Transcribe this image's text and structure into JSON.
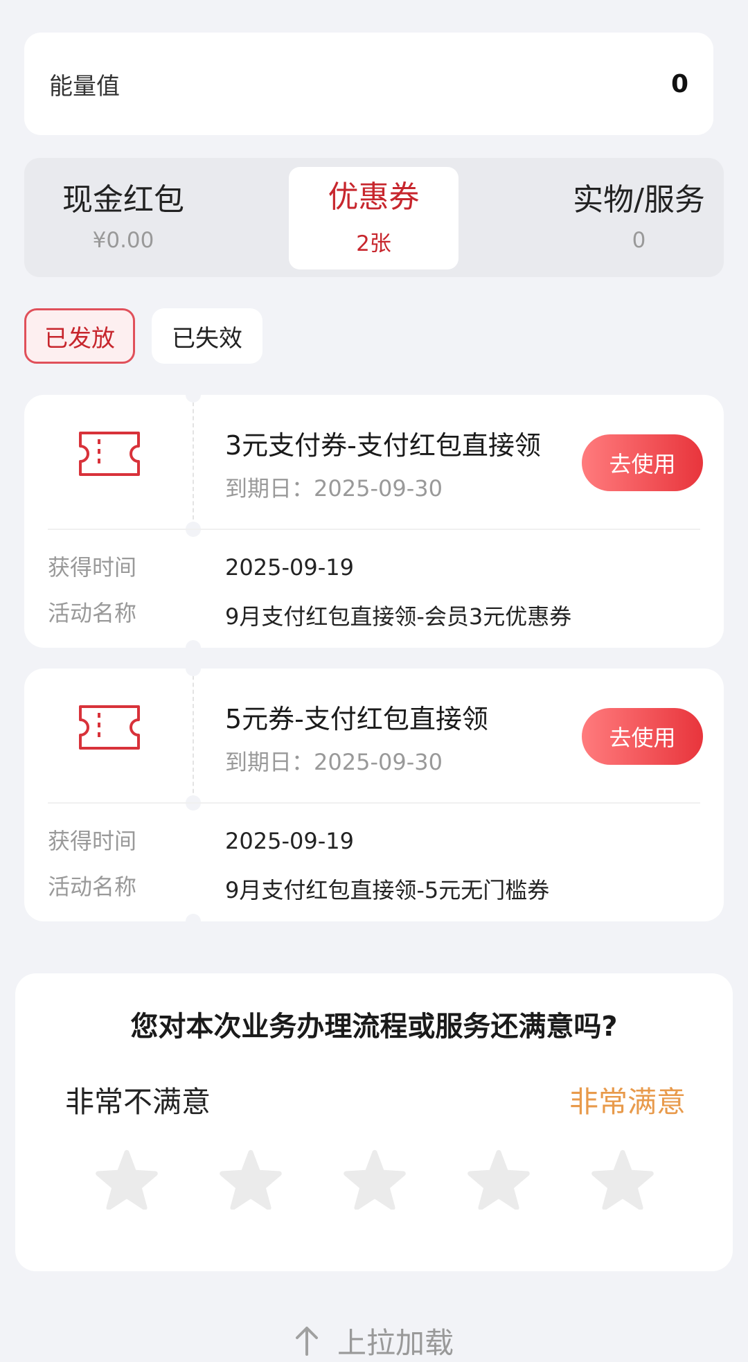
{
  "energy": {
    "label": "能量值",
    "value": "0"
  },
  "category_tabs": [
    {
      "name": "现金红包",
      "sub": "¥0.00",
      "active": false
    },
    {
      "name": "优惠券",
      "sub": "2张",
      "active": true
    },
    {
      "name": "实物/服务",
      "sub": "0",
      "active": false
    }
  ],
  "status_filters": {
    "issued": "已发放",
    "expired": "已失效"
  },
  "coupons": [
    {
      "title": "3元支付券-支付红包直接领",
      "expiry": "到期日：2025-09-30",
      "use_label": "去使用",
      "obtained_label": "获得时间",
      "obtained_value": "2025-09-19",
      "activity_label": "活动名称",
      "activity_value": "9月支付红包直接领-会员3元优惠券"
    },
    {
      "title": "5元券-支付红包直接领",
      "expiry": "到期日：2025-09-30",
      "use_label": "去使用",
      "obtained_label": "获得时间",
      "obtained_value": "2025-09-19",
      "activity_label": "活动名称",
      "activity_value": "9月支付红包直接领-5元无门槛券"
    }
  ],
  "survey": {
    "question": "您对本次业务办理流程或服务还满意吗?",
    "low_label": "非常不满意",
    "high_label": "非常满意",
    "rating": 0,
    "max_rating": 5
  },
  "footer": {
    "pull_up_label": "上拉加载"
  },
  "colors": {
    "accent": "#c7262d",
    "button": "#e8353c",
    "survey_high": "#e89a4b",
    "star_empty": "#ebebeb"
  },
  "icons": {
    "ticket": "ticket-icon",
    "star": "star-icon",
    "arrow": "arrow-up-icon"
  }
}
